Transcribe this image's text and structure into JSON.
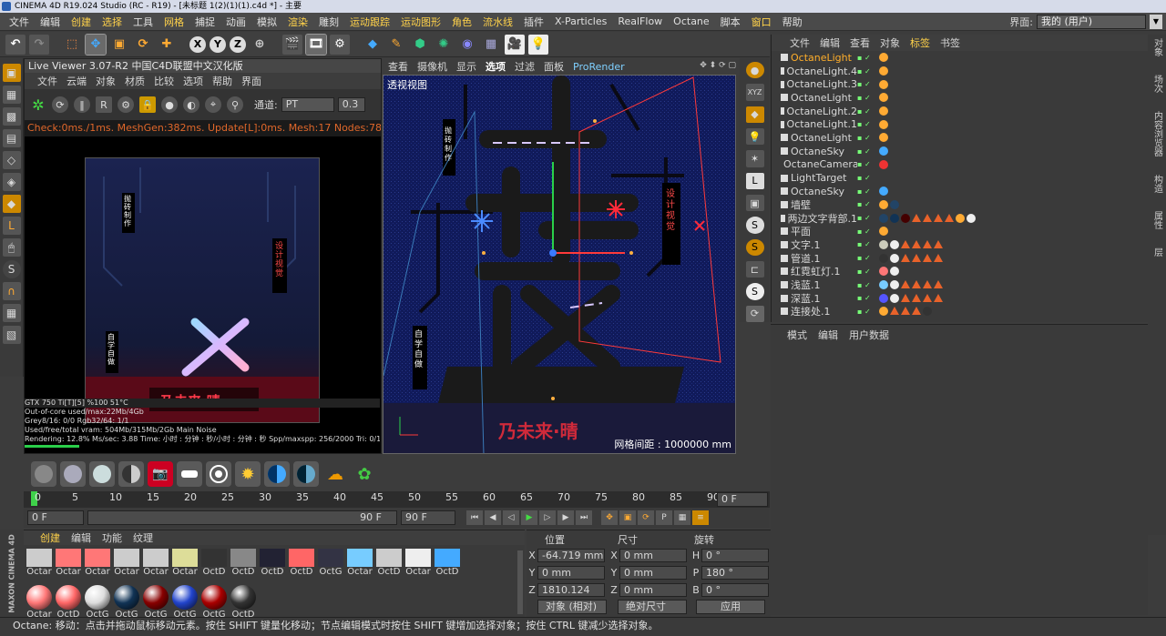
{
  "window": {
    "title": "CINEMA 4D R19.024 Studio (RC - R19) - [未标题 1(2)(1)(1).c4d *] - 主要"
  },
  "menubar": {
    "items": [
      "文件",
      "编辑",
      "创建",
      "选择",
      "工具",
      "网格",
      "捕捉",
      "动画",
      "模拟",
      "渲染",
      "雕刻",
      "运动跟踪",
      "运动图形",
      "角色",
      "流水线",
      "插件",
      "X-Particles",
      "RealFlow",
      "Octane",
      "脚本",
      "窗口",
      "帮助"
    ],
    "highlighted": [
      "创建",
      "选择",
      "网格",
      "渲染",
      "运动跟踪",
      "运动图形",
      "角色",
      "流水线",
      "窗口"
    ],
    "layout_label": "界面:",
    "layout_value": "我的 (用户)"
  },
  "live_viewer": {
    "title": "Live Viewer 3.07-R2 中国C4D联盟中文汉化版",
    "menu": [
      "文件",
      "云端",
      "对象",
      "材质",
      "比较",
      "选项",
      "帮助",
      "界面"
    ],
    "channel_label": "通道:",
    "channel_value": "PT",
    "channel_num": "0.3",
    "status": "Check:0ms./1ms. MeshGen:382ms. Update[L]:0ms. Mesh:17 Nodes:78 Movab",
    "art_text_left": "抛砖制作",
    "art_text_right": "设计视觉",
    "art_text_bottom_left": "自学自做",
    "art_text_bottom": "乃未来·晴",
    "stats": [
      "GTX 750 Ti[T][5]          %100     51°C",
      "Out-of-core used/max:22Mb/4Gb",
      "Grey8/16: 0/0          Rgb32/64: 1/1",
      "Used/free/total vram: 504Mb/315Mb/2Gb   Main   Noise",
      "Rendering: 12.8%    Ms/sec: 3.88   Time: 小时 : 分钟 : 秒/小时 : 分钟 : 秒   Spp/maxspp: 256/2000   Tri: 0/1.529m  Mesh: 23"
    ]
  },
  "viewport": {
    "menu": [
      "查看",
      "摄像机",
      "显示",
      "选项",
      "过滤",
      "面板",
      "ProRender"
    ],
    "label": "透视视图",
    "grid_spacing": "网格间距 : 1000000 mm",
    "art_text_left": "抛砖制作",
    "art_text_right": "设计视觉",
    "art_text_bottom_left": "自学自做",
    "art_text_bottom": "乃未来·晴"
  },
  "object_manager": {
    "menu": [
      "文件",
      "编辑",
      "查看",
      "对象",
      "标签",
      "书签"
    ],
    "highlighted": [
      "标签"
    ],
    "objects": [
      {
        "name": "OctaneLight",
        "selected": true
      },
      {
        "name": "OctaneLight.4"
      },
      {
        "name": "OctaneLight.3"
      },
      {
        "name": "OctaneLight"
      },
      {
        "name": "OctaneLight.2"
      },
      {
        "name": "OctaneLight.1"
      },
      {
        "name": "OctaneLight"
      },
      {
        "name": "OctaneSky"
      },
      {
        "name": "OctaneCamera"
      },
      {
        "name": "LightTarget"
      },
      {
        "name": "OctaneSky"
      },
      {
        "name": "墙壁"
      },
      {
        "name": "两边文字背部.1"
      },
      {
        "name": "平面"
      },
      {
        "name": "文字.1"
      },
      {
        "name": "管道.1"
      },
      {
        "name": "红霓虹灯.1"
      },
      {
        "name": "浅蓝.1"
      },
      {
        "name": "深蓝.1"
      },
      {
        "name": "连接处.1"
      }
    ]
  },
  "side_tabs": [
    "对象",
    "场次",
    "内容浏览器",
    "构造",
    "属性",
    "层"
  ],
  "attribute_manager": {
    "menu": [
      "模式",
      "编辑",
      "用户数据"
    ]
  },
  "timeline": {
    "ticks": [
      "0",
      "5",
      "10",
      "15",
      "20",
      "25",
      "30",
      "35",
      "40",
      "45",
      "50",
      "55",
      "60",
      "65",
      "70",
      "75",
      "80",
      "85",
      "90"
    ],
    "end_field": "0 F",
    "start": "0 F",
    "range_end": "90 F",
    "end": "90 F"
  },
  "material_manager": {
    "menu": [
      "创建",
      "编辑",
      "功能",
      "纹理"
    ],
    "highlighted": [
      "创建"
    ],
    "row1": [
      "Octar",
      "Octar",
      "Octar",
      "Octar",
      "Octar",
      "Octar",
      "OctD",
      "OctD",
      "OctD",
      "OctD",
      "OctG",
      "Octar",
      "OctD",
      "Octar",
      "OctD"
    ],
    "row2": [
      "Octar",
      "OctD",
      "OctG",
      "OctG",
      "OctG",
      "OctG",
      "OctG",
      "OctD"
    ],
    "brand": "MAXON CINEMA 4D"
  },
  "coordinates": {
    "headers": [
      "位置",
      "尺寸",
      "旋转"
    ],
    "rows": [
      {
        "axis": "X",
        "pos": "-64.719 mm",
        "size_axis": "X",
        "size": "0 mm",
        "rot_axis": "H",
        "rot": "0 °"
      },
      {
        "axis": "Y",
        "pos": "0 mm",
        "size_axis": "Y",
        "size": "0 mm",
        "rot_axis": "P",
        "rot": "180 °"
      },
      {
        "axis": "Z",
        "pos": "1810.124 mm",
        "size_axis": "Z",
        "size": "0 mm",
        "rot_axis": "B",
        "rot": "0 °"
      }
    ],
    "mode_select": "对象 (相对)",
    "size_select": "绝对尺寸",
    "apply": "应用"
  },
  "statusbar": {
    "text": "Octane:    移动：点击并拖动鼠标移动元素。按住 SHIFT 键量化移动；节点编辑模式时按住 SHIFT 键增加选择对象；按住 CTRL 键减少选择对象。"
  },
  "colors": {
    "accent": "#ffd24a",
    "viewport_bg": "#101a5a",
    "neon_red": "#ff2a3a",
    "neon_blue": "#7ab8ff"
  }
}
